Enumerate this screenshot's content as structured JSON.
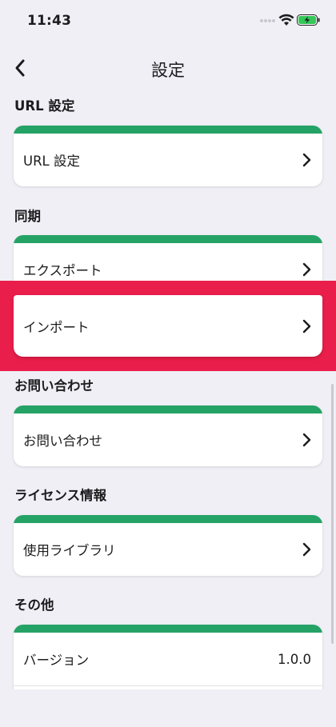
{
  "status_bar": {
    "time": "11:43"
  },
  "nav": {
    "title": "設定"
  },
  "sections": {
    "url": {
      "header": "URL 設定",
      "row_label": "URL 設定"
    },
    "sync": {
      "header": "同期",
      "export_label": "エクスポート",
      "import_label": "インポート"
    },
    "contact": {
      "header": "お問い合わせ",
      "row_label": "お問い合わせ"
    },
    "license": {
      "header": "ライセンス情報",
      "row_label": "使用ライブラリ"
    },
    "other": {
      "header": "その他",
      "version_label": "バージョン",
      "version_value": "1.0.0"
    }
  },
  "colors": {
    "accent": "#25a266",
    "highlight": "#ea1e4a",
    "background": "#f0eff5"
  }
}
